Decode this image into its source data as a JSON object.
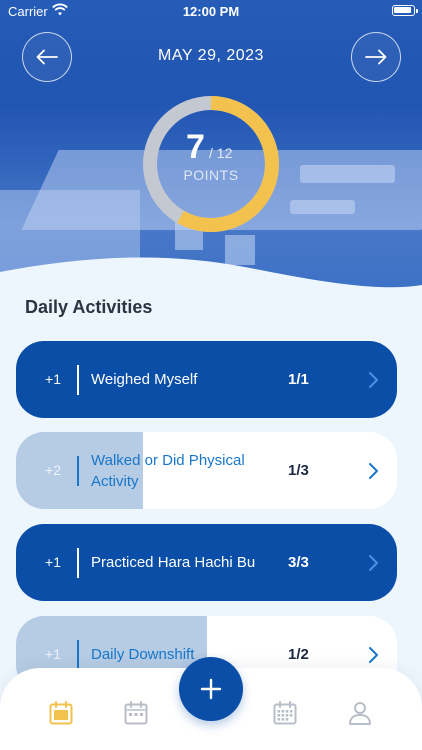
{
  "status_bar": {
    "carrier": "Carrier",
    "time": "12:00 PM"
  },
  "header": {
    "date": "MAY 29, 2023",
    "prev_icon": "arrow-left-icon",
    "next_icon": "arrow-right-icon"
  },
  "score": {
    "points": "7",
    "total": "/ 12",
    "label": "POINTS",
    "fraction": 0.583,
    "colors": {
      "progress": "#f2c14e",
      "track": "#c4c9d1"
    }
  },
  "section_title": "Daily Activities",
  "activities": [
    {
      "points": "+1",
      "label": "Weighed Myself",
      "progress": "1/1",
      "fill": 1.0
    },
    {
      "points": "+2",
      "label": "Walked or Did Physical Activity",
      "progress": "1/3",
      "fill": 0.333
    },
    {
      "points": "+1",
      "label": "Practiced Hara Hachi Bu",
      "progress": "3/3",
      "fill": 1.0
    },
    {
      "points": "+1",
      "label": "Daily Downshift",
      "progress": "1/2",
      "fill": 0.5
    }
  ],
  "tab_bar": {
    "tabs": [
      {
        "icon": "calendar-today-icon",
        "active": true
      },
      {
        "icon": "calendar-week-icon",
        "active": false
      },
      {
        "icon": "add-icon",
        "active": false
      },
      {
        "icon": "calendar-month-icon",
        "active": false
      },
      {
        "icon": "profile-icon",
        "active": false
      }
    ]
  },
  "colors": {
    "primary": "#0a4ea8",
    "accent": "#1877c9",
    "active_tab": "#f2c14e",
    "inactive_tab": "#b8bec7"
  }
}
